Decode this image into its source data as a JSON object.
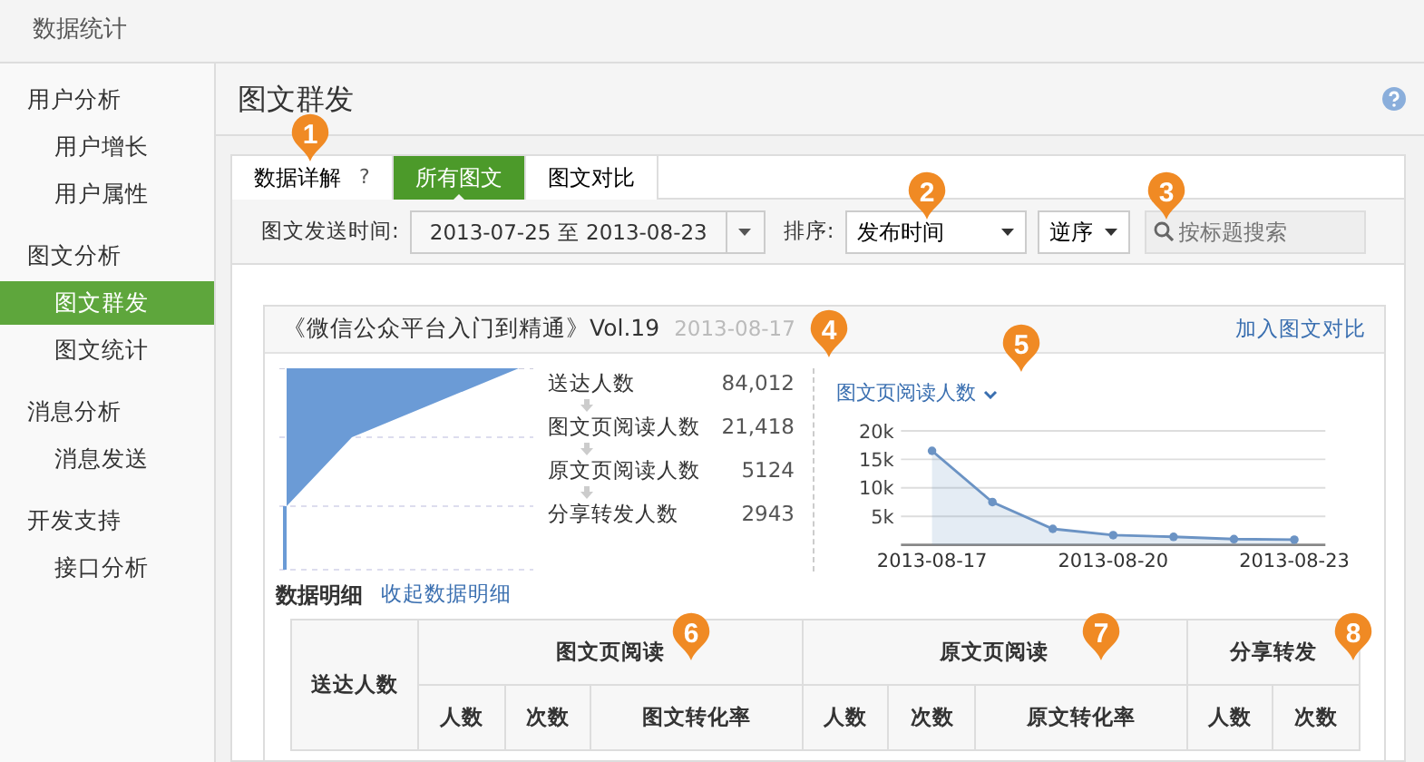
{
  "header": {
    "title": "数据统计"
  },
  "sidebar": [
    {
      "title": "用户分析",
      "items": [
        {
          "label": "用户增长",
          "selected": false
        },
        {
          "label": "用户属性",
          "selected": false
        }
      ]
    },
    {
      "title": "图文分析",
      "items": [
        {
          "label": "图文群发",
          "selected": true
        },
        {
          "label": "图文统计",
          "selected": false
        }
      ]
    },
    {
      "title": "消息分析",
      "items": [
        {
          "label": "消息发送",
          "selected": false
        }
      ]
    },
    {
      "title": "开发支持",
      "items": [
        {
          "label": "接口分析",
          "selected": false
        }
      ]
    }
  ],
  "page": {
    "title": "图文群发"
  },
  "tabs": [
    {
      "label": "数据详解",
      "help": "?",
      "selected": false
    },
    {
      "label": "所有图文",
      "selected": true
    },
    {
      "label": "图文对比",
      "selected": false
    }
  ],
  "filters": {
    "date_label": "图文发送时间:",
    "date_range": "2013-07-25 至 2013-08-23",
    "sort_label": "排序:",
    "sort_by": "发布时间",
    "order": "逆序",
    "search_placeholder": "按标题搜索"
  },
  "article": {
    "title": "《微信公众平台入门到精通》Vol.19",
    "date": "2013-08-17",
    "compare_link": "加入图文对比",
    "funnel": [
      {
        "label": "送达人数",
        "value": "84,012"
      },
      {
        "label": "图文页阅读人数",
        "value": "21,418"
      },
      {
        "label": "原文页阅读人数",
        "value": "5124"
      },
      {
        "label": "分享转发人数",
        "value": "2943"
      }
    ],
    "chart": {
      "metric": "图文页阅读人数",
      "chart_data": {
        "type": "area",
        "categories": [
          "2013-08-17",
          null,
          null,
          "2013-08-20",
          null,
          null,
          "2013-08-23"
        ],
        "grid": true,
        "series": [
          {
            "color": "#6b93c4",
            "values": [
              16500,
              7500,
              2800,
              1700,
              1400,
              1000,
              900
            ]
          }
        ],
        "ylim": [
          0,
          20000
        ],
        "yticks": [
          {
            "value": 5000,
            "label": "5k"
          },
          {
            "value": 10000,
            "label": "10k"
          },
          {
            "value": 15000,
            "label": "15k"
          },
          {
            "value": 20000,
            "label": "20k"
          }
        ]
      }
    }
  },
  "details": {
    "title": "数据明细",
    "toggle": "收起数据明细",
    "first_column": "送达人数",
    "groups": [
      {
        "label": "图文页阅读",
        "columns": [
          "人数",
          "次数",
          "图文转化率"
        ]
      },
      {
        "label": "原文页阅读",
        "columns": [
          "人数",
          "次数",
          "原文转化率"
        ]
      },
      {
        "label": "分享转发",
        "columns": [
          "人数",
          "次数"
        ]
      }
    ]
  },
  "markers": [
    "1",
    "2",
    "3",
    "4",
    "5",
    "6",
    "7",
    "8"
  ]
}
